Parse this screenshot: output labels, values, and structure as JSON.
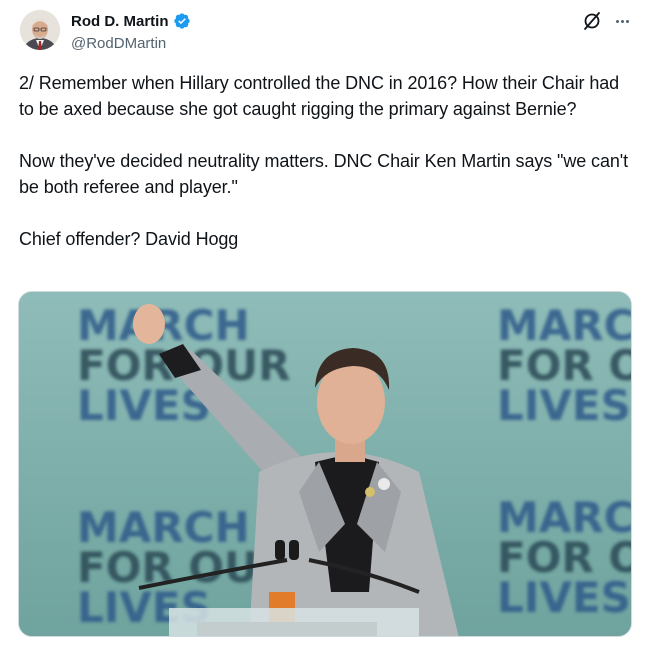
{
  "author": {
    "name": "Rod D. Martin",
    "handle": "@RodDMartin",
    "avatar_icon": "profile-photo",
    "verified_icon": "verified-badge-icon",
    "verified_color": "#1d9bf0"
  },
  "header_actions": {
    "grok_icon": "grok-icon",
    "more_icon": "more-options-icon"
  },
  "post": {
    "text": "2/ Remember when Hillary controlled the DNC in 2016? How their Chair had to be axed because she got caught rigging the primary against Bernie?\n\nNow they've decided neutrality matters. DNC Chair Ken Martin says \"we can't be both referee and player.\"\n\nChief offender? David Hogg"
  },
  "media": {
    "backdrop_text": {
      "line1": "MARCH",
      "line2": "FOR OUR",
      "line3": "LIVES"
    }
  }
}
